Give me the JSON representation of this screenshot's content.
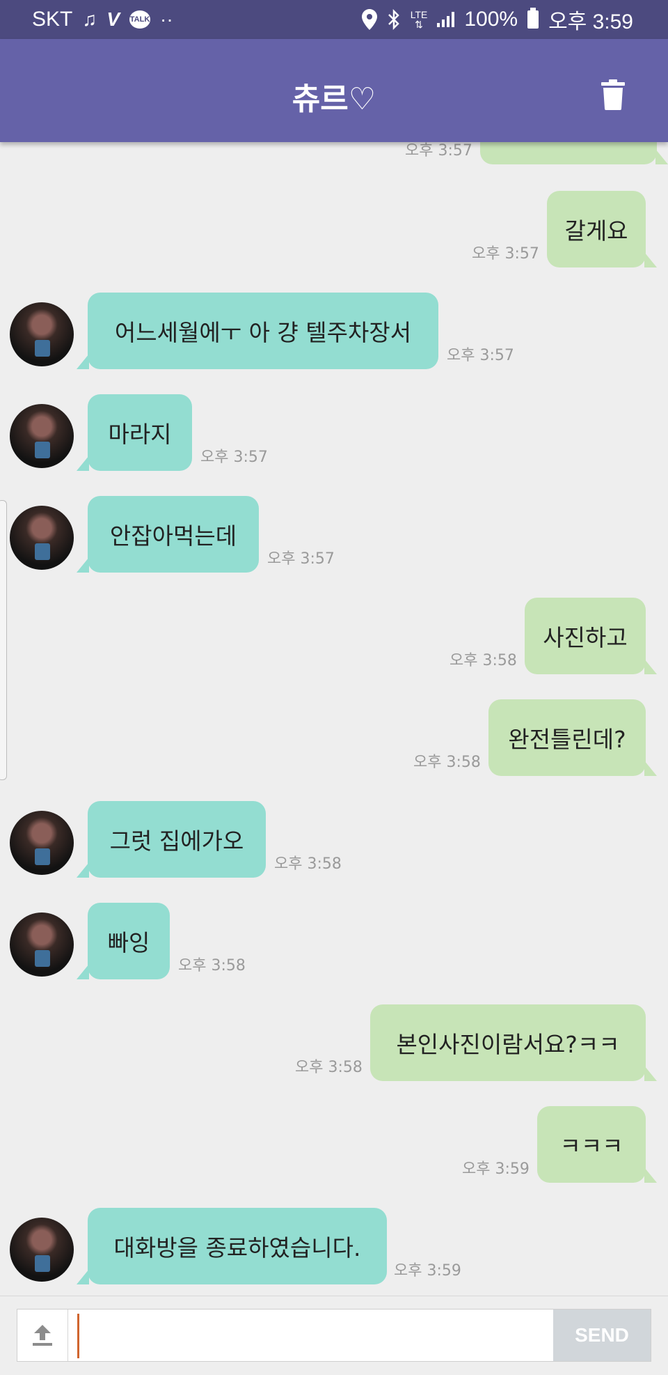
{
  "status_bar": {
    "carrier": "SKT",
    "network": "LTE",
    "battery": "100%",
    "time": "오후 3:59",
    "notification_icons": [
      "headset-icon",
      "v-app-icon",
      "kakaotalk-icon",
      "more-dots-icon"
    ],
    "system_icons": [
      "location-icon",
      "bluetooth-icon",
      "lte-icon",
      "signal-icon",
      "battery-icon"
    ]
  },
  "header": {
    "title": "츄르♡",
    "action_icon": "trash-icon",
    "background": "#6562a8"
  },
  "messages": [
    {
      "dir": "out",
      "text": "",
      "time": "오후 3:57"
    },
    {
      "dir": "out",
      "text": "갈게요",
      "time": "오후 3:57"
    },
    {
      "dir": "in",
      "text": "어느세월에ㅜ 아 걍 텔주차장서",
      "time": "오후 3:57"
    },
    {
      "dir": "in",
      "text": "마라지",
      "time": "오후 3:57"
    },
    {
      "dir": "in",
      "text": "안잡아먹는데",
      "time": "오후 3:57"
    },
    {
      "dir": "out",
      "text": "사진하고",
      "time": "오후 3:58"
    },
    {
      "dir": "out",
      "text": "완전틀린데?",
      "time": "오후 3:58"
    },
    {
      "dir": "in",
      "text": "그럿 집에가오",
      "time": "오후 3:58"
    },
    {
      "dir": "in",
      "text": "빠잉",
      "time": "오후 3:58"
    },
    {
      "dir": "out",
      "text": "본인사진이람서요?ㅋㅋ",
      "time": "오후 3:58"
    },
    {
      "dir": "out",
      "text": "ㅋㅋㅋ",
      "time": "오후 3:59"
    },
    {
      "dir": "in",
      "text": "대화방을 종료하였습니다.",
      "time": "오후 3:59"
    }
  ],
  "composer": {
    "input_value": "",
    "send_label": "SEND",
    "upload_icon": "upload-icon"
  },
  "colors": {
    "outgoing_bubble": "#c7e4b7",
    "incoming_bubble": "#93ddd1",
    "status_bar": "#4c4a7f"
  }
}
